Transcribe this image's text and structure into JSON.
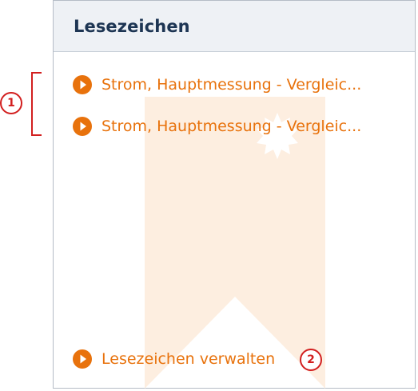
{
  "panel": {
    "title": "Lesezeichen",
    "bookmarks": [
      {
        "label": "Strom, Hauptmessung - Vergleic...",
        "icon": "play-circle-icon"
      },
      {
        "label": "Strom, Hauptmessung - Vergleic...",
        "icon": "play-circle-icon"
      }
    ],
    "manage": {
      "label": "Lesezeichen verwalten",
      "icon": "play-circle-icon"
    },
    "watermark_icon": "bookmark-icon"
  },
  "annotations": {
    "callout_1": "1",
    "callout_2": "2"
  },
  "colors": {
    "accent": "#e8720c",
    "title": "#1d3553",
    "header_bg": "#eef1f5",
    "border": "#b5bcc6",
    "watermark": "#fdeee0",
    "callout": "#d21f1f"
  }
}
